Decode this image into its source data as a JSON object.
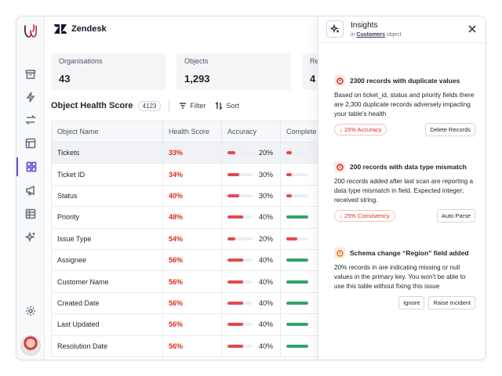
{
  "app": {
    "name": "Zendesk"
  },
  "colors": {
    "accent": "#6d4ad6",
    "danger": "#d92d20",
    "bar_red": "#e5484d",
    "bar_green": "#30a46c"
  },
  "stats": [
    {
      "label": "Organisations",
      "value": "43"
    },
    {
      "label": "Objects",
      "value": "1,293"
    },
    {
      "label": "Re",
      "value": "4"
    }
  ],
  "toolbar": {
    "title": "Object Health Score",
    "count": "4123",
    "filter_label": "Filter",
    "sort_label": "Sort"
  },
  "table": {
    "columns": [
      "Object Name",
      "Health Score",
      "Accuracy",
      "Complete"
    ],
    "rows": [
      {
        "name": "Tickets",
        "score": "33%",
        "accuracy": 20,
        "accuracy_label": "20%",
        "completeness": 25
      },
      {
        "name": "Ticket ID",
        "score": "34%",
        "accuracy": 30,
        "accuracy_label": "30%",
        "completeness": 25
      },
      {
        "name": "Status",
        "score": "40%",
        "accuracy": 30,
        "accuracy_label": "30%",
        "completeness": 25
      },
      {
        "name": "Priority",
        "score": "48%",
        "accuracy": 40,
        "accuracy_label": "40%",
        "completeness": 100
      },
      {
        "name": "Issue Type",
        "score": "54%",
        "accuracy": 20,
        "accuracy_label": "20%",
        "completeness": 50
      },
      {
        "name": "Assignee",
        "score": "56%",
        "accuracy": 40,
        "accuracy_label": "40%",
        "completeness": 100
      },
      {
        "name": "Customer Name",
        "score": "56%",
        "accuracy": 40,
        "accuracy_label": "40%",
        "completeness": 100
      },
      {
        "name": "Created Date",
        "score": "56%",
        "accuracy": 40,
        "accuracy_label": "40%",
        "completeness": 100
      },
      {
        "name": "Last Updated",
        "score": "56%",
        "accuracy": 40,
        "accuracy_label": "40%",
        "completeness": 100
      },
      {
        "name": "Resolution Date",
        "score": "56%",
        "accuracy": 40,
        "accuracy_label": "40%",
        "completeness": 100
      }
    ]
  },
  "insights": {
    "title": "Insights",
    "subtitle_prefix": "in",
    "subtitle_object": "Customers",
    "subtitle_suffix": "object",
    "items": [
      {
        "title": "2300 records with duplicate values",
        "body": "Based on ticket_id, status and priority fields there are 2,300 duplicate records adversely impacting your table's health",
        "tag": "15% Accuracy",
        "action": "Delete Records",
        "severity": "error"
      },
      {
        "title": "200 records with data type mismatch",
        "body": "200 records added after last scan are reporting a data type mismatch in field. Expected integer; received string.",
        "tag": "25% Consistency",
        "action": "Auto Parse",
        "severity": "error"
      },
      {
        "title": "Schema change “Region” field added",
        "body": "20% records in are indicating missing or null values in the primary key. You won't be able to use this table without fixing this issue",
        "actions": [
          "Ignore",
          "Raise Incident"
        ],
        "severity": "warning"
      }
    ]
  }
}
